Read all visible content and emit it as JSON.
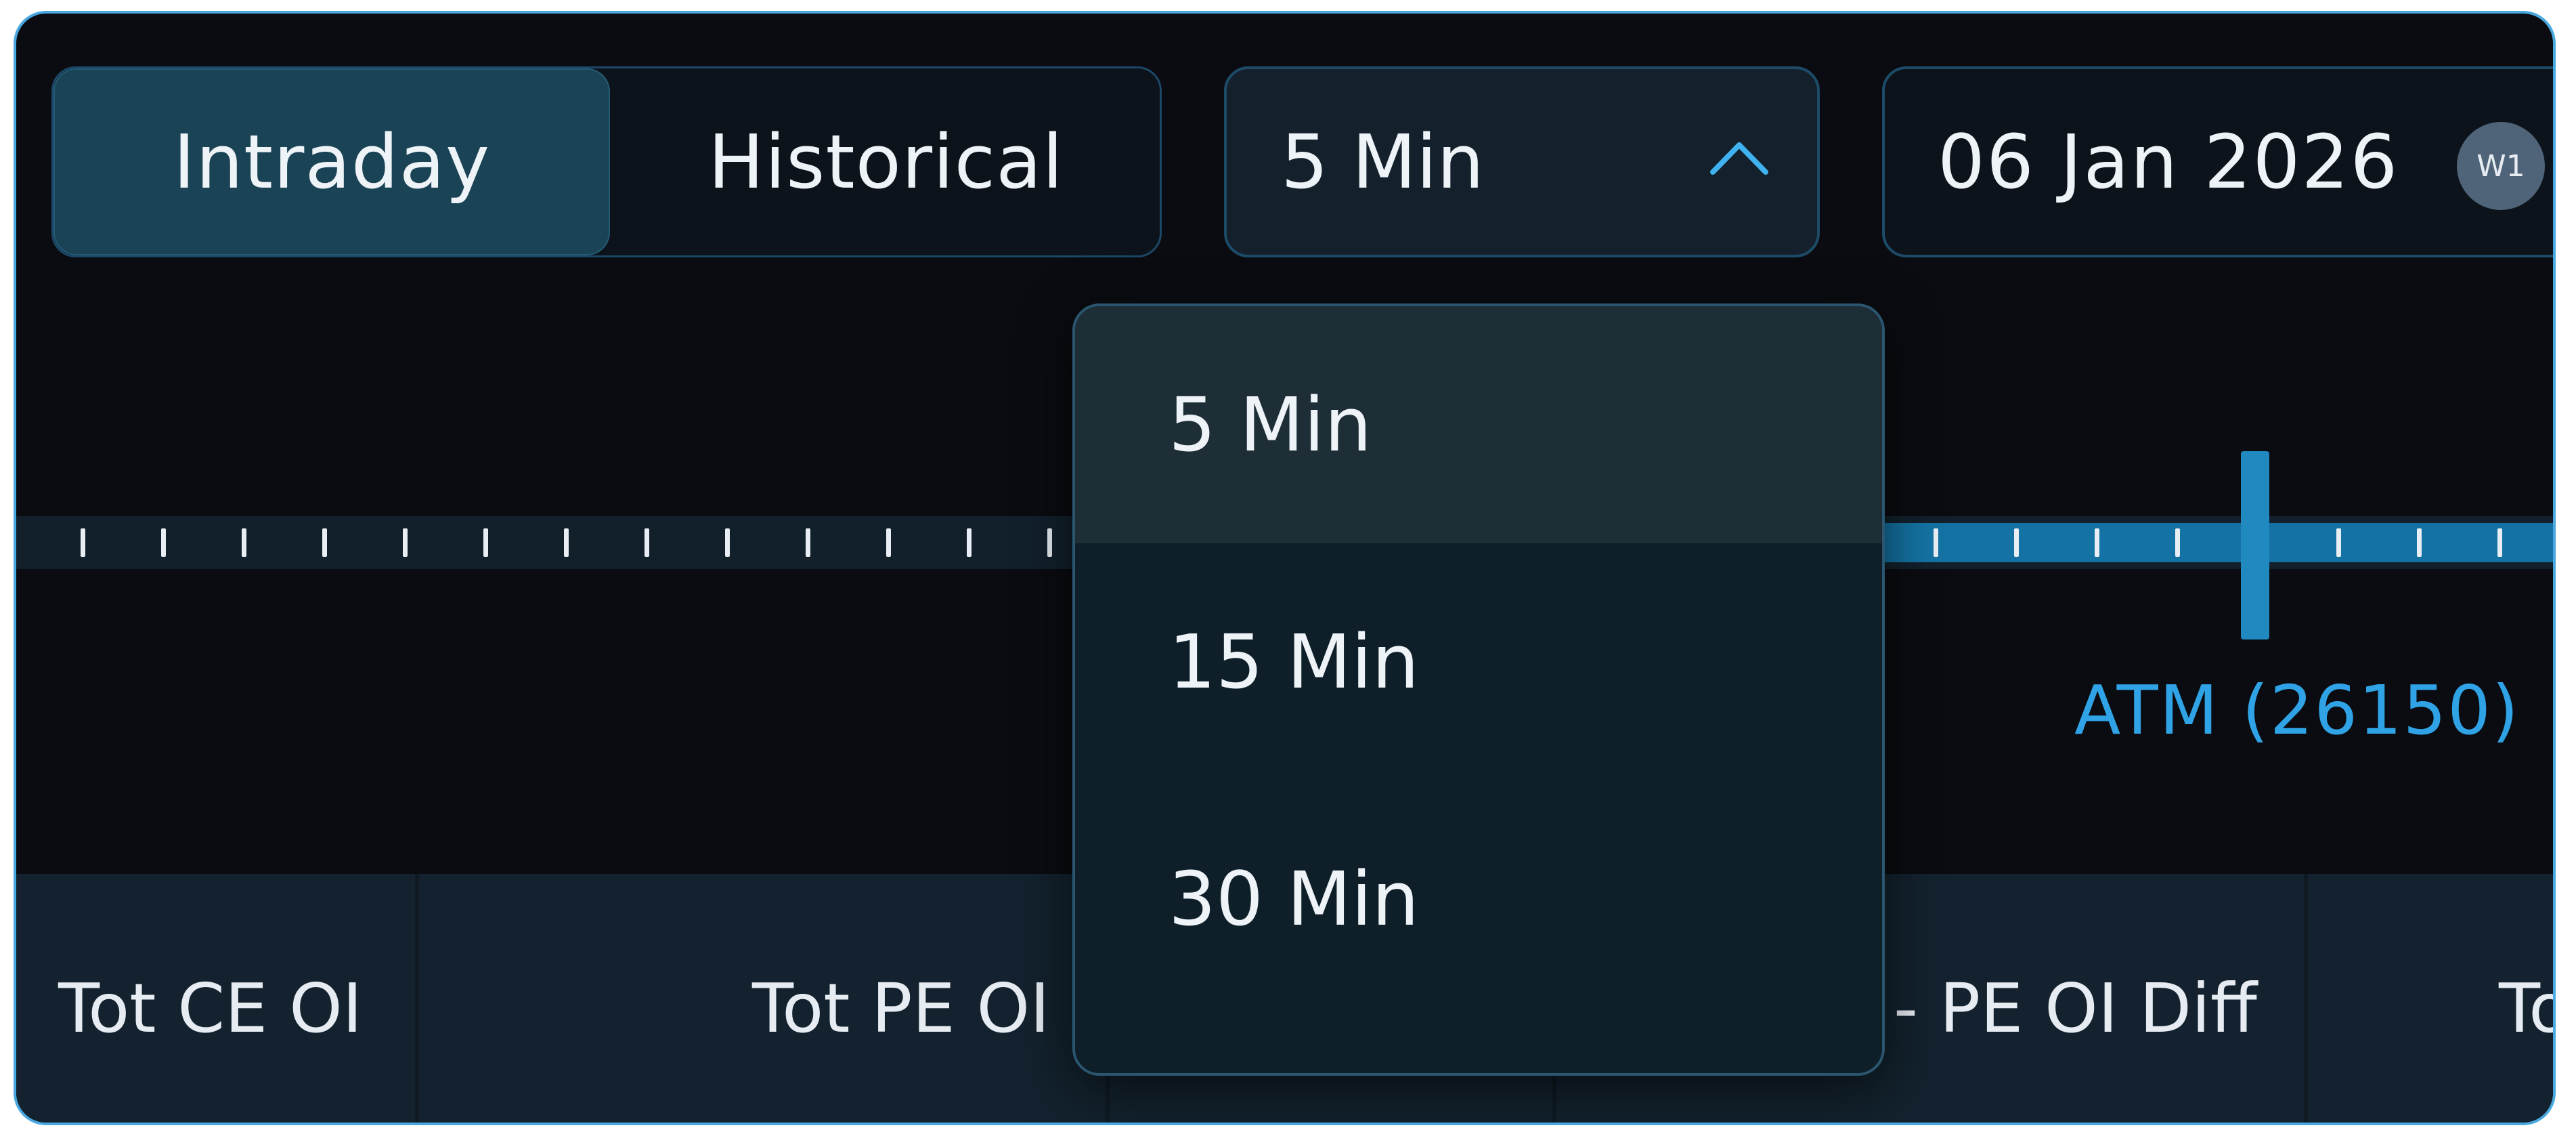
{
  "mode_toggle": {
    "options": [
      "Intraday",
      "Historical"
    ],
    "selected": "Intraday"
  },
  "interval_select": {
    "value": "5 Min",
    "expanded": true,
    "options": [
      "5 Min",
      "15 Min",
      "30 Min"
    ]
  },
  "expiry": {
    "date": "06 Jan 2026",
    "week_badge": "W1"
  },
  "strike_ruler": {
    "atm_label": "ATM (26150)"
  },
  "table_header": {
    "columns": [
      "Tot CE OI",
      "Tot PE OI",
      "",
      "- PE OI Diff",
      "To"
    ]
  },
  "colors": {
    "accent": "#2fa3e6",
    "active_segment": "#1a4356",
    "background": "#0a0c11",
    "frame_border": "#4aa8e0"
  },
  "icons": {
    "dropdown_toggle": "chevron-up-icon",
    "week_indicator": "week-badge"
  }
}
